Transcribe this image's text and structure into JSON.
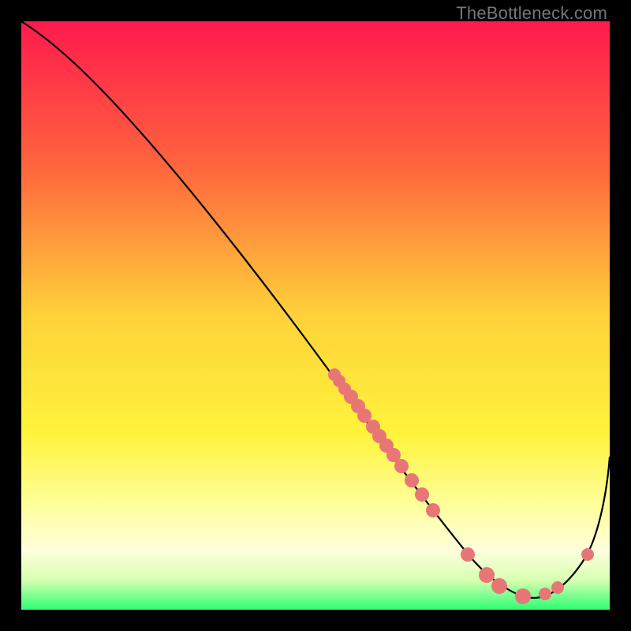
{
  "watermark": "TheBottleneck.com",
  "chart_data": {
    "type": "line",
    "title": "",
    "xlabel": "",
    "ylabel": "",
    "xlim": [
      0,
      100
    ],
    "ylim": [
      0,
      100
    ],
    "grid": false,
    "legend": false,
    "background_gradient": {
      "type": "vertical",
      "stops": [
        {
          "t": 0.0,
          "color": "#ff1a4d"
        },
        {
          "t": 0.25,
          "color": "#ff663d"
        },
        {
          "t": 0.5,
          "color": "#ffd23a"
        },
        {
          "t": 0.7,
          "color": "#fff33b"
        },
        {
          "t": 0.82,
          "color": "#ffff99"
        },
        {
          "t": 0.9,
          "color": "#ffffdd"
        },
        {
          "t": 0.95,
          "color": "#d6ffb0"
        },
        {
          "t": 1.0,
          "color": "#2dff73"
        }
      ]
    },
    "series": [
      {
        "name": "curve",
        "color": "#000000",
        "x": [
          0,
          4,
          8,
          12,
          16,
          20,
          24,
          28,
          32,
          36,
          40,
          44,
          48,
          52,
          56,
          60,
          64,
          68,
          72,
          76,
          80,
          82,
          84,
          86,
          88,
          90,
          92,
          94,
          96,
          98,
          100
        ],
        "y": [
          100,
          97.5,
          94,
          90,
          85,
          79.5,
          73.5,
          67.5,
          61.5,
          55.5,
          49.5,
          43.5,
          37.5,
          32,
          26.5,
          21.5,
          17,
          13,
          9.5,
          6.5,
          4,
          3,
          2.3,
          2,
          2.1,
          3,
          5,
          8.5,
          13,
          19,
          26
        ]
      }
    ],
    "markers": [
      {
        "name": "cluster-upper",
        "color": "#e97676",
        "x_range": [
          52,
          58
        ],
        "y_range": [
          26,
          38
        ],
        "count": 6
      },
      {
        "name": "cluster-mid",
        "color": "#e97676",
        "x_range": [
          58,
          72
        ],
        "y_range": [
          10,
          26
        ],
        "count": 8
      },
      {
        "name": "cluster-valley",
        "color": "#e97676",
        "x_range": [
          76,
          90
        ],
        "y_range": [
          2,
          6
        ],
        "count": 6
      },
      {
        "name": "marker-right",
        "color": "#e97676",
        "x": 94,
        "y": 9
      }
    ]
  }
}
